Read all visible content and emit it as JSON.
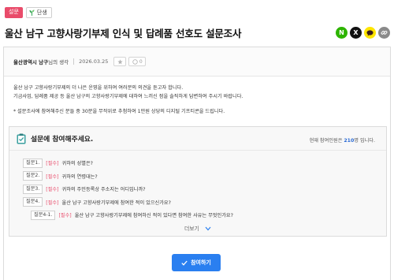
{
  "tags": {
    "primary": "설문",
    "secondary": "단생"
  },
  "title": "울산 남구 고향사랑기부제 인식 및 답례품 선호도 설문조사",
  "share": [
    {
      "name": "naver",
      "glyph": "N",
      "color": "#2db400"
    },
    {
      "name": "x",
      "glyph": "X",
      "color": "#111111"
    },
    {
      "name": "kakao",
      "glyph": "",
      "color": "#fee500"
    },
    {
      "name": "link",
      "glyph": "",
      "color": "#8a8a8a"
    }
  ],
  "meta": {
    "author": "울산광역시 남구",
    "author_suffix": " 님의 생각",
    "date": "2026.03.25",
    "views_label": "0"
  },
  "intro": {
    "line1": "울산 남구 고향사랑기부제의 더 나은 운영을 위하여 여러분의 의견을 듣고자 합니다.",
    "line2": "기금사업, 답례품 제공 등 울산 남구의 고향사랑기부제에 대하여 느끼신 점을 솔직하게 답변하여 주시기 바랍니다.",
    "line3": "* 설문조사에 참여해주신 분들 중 30분을 무작위로 추첨하여 1만원 상당의 디지털 기프티콘을 드립니다."
  },
  "survey": {
    "heading": "설문에 참여해주세요.",
    "count_prefix": "현재 참여인원은 ",
    "count_value": "210",
    "count_suffix": "명 입니다.",
    "questions": [
      {
        "num": "질문1.",
        "req": "[필수]",
        "text": "귀하의 성별은?"
      },
      {
        "num": "질문2.",
        "req": "[필수]",
        "text": "귀하의 연령대는?"
      },
      {
        "num": "질문3.",
        "req": "[필수]",
        "text": "귀하의 주민등록상 주소지는 어디입니까?"
      },
      {
        "num": "질문4.",
        "req": "[필수]",
        "text": "울산 남구 고향사랑기부제에 참여한 적이 있으신가요?"
      },
      {
        "num": "질문4-1.",
        "req": "[필수]",
        "text": "울산 남구 고향사랑기부제에 참여하신 적이 있다면 참여한 사유는 무엇인가요?"
      }
    ],
    "more_label": "더보기"
  },
  "cta": {
    "label": "참여하기"
  },
  "colors": {
    "accent": "#2a7ff0",
    "required": "#e94b6a",
    "count": "#2a6ad4"
  }
}
